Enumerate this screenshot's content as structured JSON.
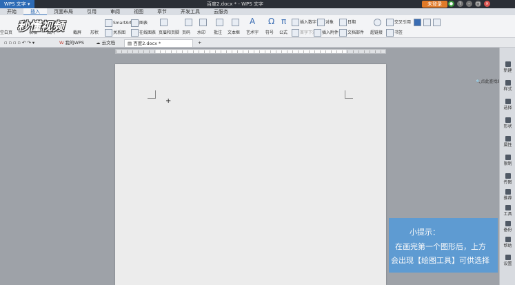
{
  "window": {
    "app_menu": "WPS 文字 ▾",
    "doc_title": "百度2.docx * - WPS 文字",
    "login": "未登录"
  },
  "ribbon_tabs": [
    "开始",
    "插入",
    "页面布局",
    "引用",
    "审阅",
    "视图",
    "章节",
    "开发工具",
    "云服务"
  ],
  "ribbon": {
    "blank_page": "空白页",
    "table": "表格",
    "picture": "图片",
    "screenshot": "截屏",
    "shape": "形状",
    "smartart": "SmartArt",
    "chart": "图表",
    "relation_chart": "关系图",
    "online_chart": "在线图表",
    "header_footer": "页眉和页脚",
    "page_number": "页码",
    "watermark": "水印",
    "comment": "批注",
    "textbox": "文本框",
    "art_text": "艺术字",
    "symbol": "符号",
    "formula": "公式",
    "insert_number": "插入数字",
    "object": "对象",
    "date": "日期",
    "first_drop": "首字下沉",
    "insert_attachment": "插入附件",
    "doc_parts": "文档部件",
    "hyperlink": "超链接",
    "cross_ref": "交叉引用",
    "bookmark": "书签"
  },
  "doc_tabs": {
    "my_wps": "我的WPS",
    "cloud_doc": "云文档",
    "current": "百度2.docx *",
    "add": "+"
  },
  "find_label": "点此查找命令",
  "watermark_logo": "秒懂视频",
  "right_panel": [
    "新建",
    "样式",
    "选择",
    "形状",
    "属性",
    "限制",
    "传图",
    "推荐",
    "工具",
    "备份",
    "帮助",
    "设置"
  ],
  "tip": {
    "title": "小提示：",
    "line1": "在画完第一个图形后，上方",
    "line2": "会出现【绘图工具】可供选择"
  }
}
